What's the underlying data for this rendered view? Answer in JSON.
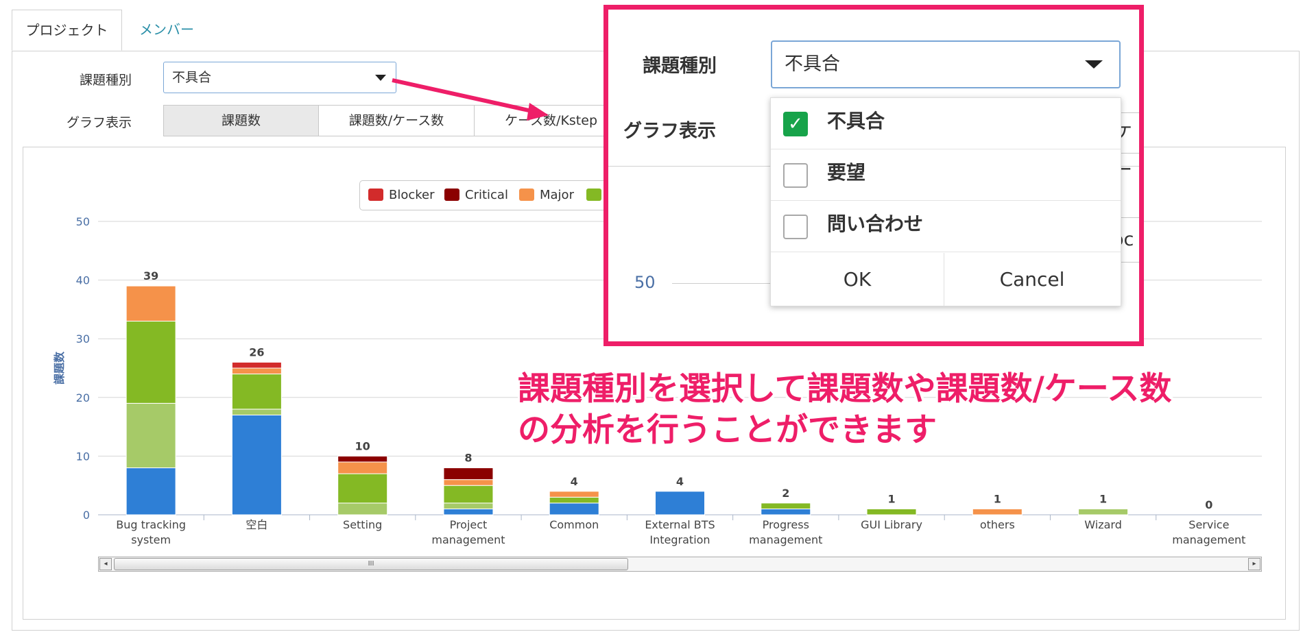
{
  "tabs": [
    {
      "label": "プロジェクト"
    },
    {
      "label": "メンバー"
    }
  ],
  "form": {
    "issue_type_label": "課題種別",
    "issue_type_value": "不具合",
    "graph_label": "グラフ表示",
    "graph_options": [
      "課題数",
      "課題数/ケース数",
      "ケース数/Kstep"
    ]
  },
  "legend": [
    {
      "label": "Blocker",
      "color": "#d22b2b"
    },
    {
      "label": "Critical",
      "color": "#8b0000"
    },
    {
      "label": "Major",
      "color": "#f5924a"
    }
  ],
  "chart_data": {
    "type": "bar",
    "stacked": true,
    "ylabel": "課題数",
    "ylim": [
      0,
      50
    ],
    "yticks": [
      "0",
      "10",
      "20",
      "30",
      "40",
      "50"
    ],
    "categories": [
      [
        "Bug tracking",
        "system"
      ],
      [
        "空白"
      ],
      [
        "Setting"
      ],
      [
        "Project",
        "management"
      ],
      [
        "Common"
      ],
      [
        "External BTS",
        "Integration"
      ],
      [
        "Progress",
        "management"
      ],
      [
        "GUI Library"
      ],
      [
        "others"
      ],
      [
        "Wizard"
      ],
      [
        "Service",
        "management"
      ]
    ],
    "totals": [
      "39",
      "26",
      "10",
      "8",
      "4",
      "4",
      "2",
      "1",
      "1",
      "1",
      "0"
    ],
    "series": [
      {
        "color": "#2e7fd6",
        "values": [
          8,
          17,
          0,
          1,
          2,
          4,
          1,
          0,
          0,
          0,
          0
        ]
      },
      {
        "color": "#a6ca68",
        "values": [
          11,
          1,
          2,
          1,
          0,
          0,
          0,
          0,
          0,
          1,
          0
        ]
      },
      {
        "color": "#84b924",
        "values": [
          14,
          6,
          5,
          3,
          1,
          0,
          1,
          1,
          0,
          0,
          0
        ]
      },
      {
        "name": "Major",
        "color": "#f5924a",
        "values": [
          6,
          1,
          2,
          1,
          1,
          0,
          0,
          0,
          1,
          0,
          0
        ]
      },
      {
        "name": "Blocker",
        "color": "#d22b2b",
        "values": [
          0,
          1,
          0,
          0,
          0,
          0,
          0,
          0,
          0,
          0,
          0
        ]
      },
      {
        "name": "Critical",
        "color": "#8b0000",
        "values": [
          0,
          0,
          1,
          2,
          0,
          0,
          0,
          0,
          0,
          0,
          0
        ]
      }
    ]
  },
  "scrollbar": {
    "left_arrow": "◂",
    "right_arrow": "▸",
    "grip": "III"
  },
  "callout": {
    "issue_type_label": "課題種別",
    "issue_type_value": "不具合",
    "graph_label": "グラフ表示",
    "partial_seg": "ケー",
    "partial_legend": "Bloc",
    "ytick": "50",
    "options": [
      {
        "label": "不具合",
        "checked": true
      },
      {
        "label": "要望",
        "checked": false
      },
      {
        "label": "問い合わせ",
        "checked": false
      }
    ],
    "ok": "OK",
    "cancel": "Cancel"
  },
  "annotation": {
    "line1": "課題種別を選択して課題数や課題数/ケース数",
    "line2": "の分析を行うことができます"
  }
}
